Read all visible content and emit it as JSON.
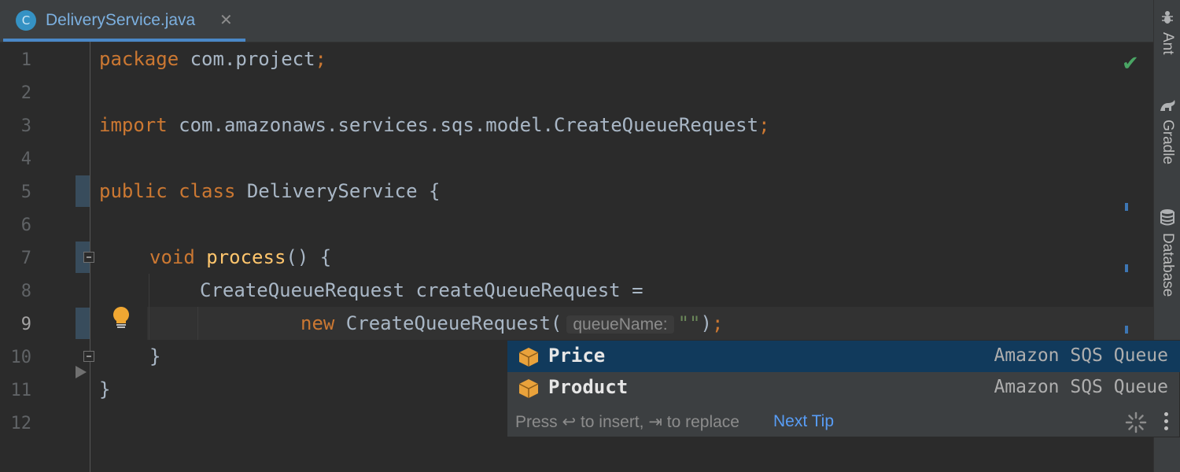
{
  "tab": {
    "title": "DeliveryService.java",
    "icon": "C",
    "close": "✕"
  },
  "toolwindows": [
    {
      "label": "Ant",
      "icon": "ant-icon"
    },
    {
      "label": "Gradle",
      "icon": "gradle-icon"
    },
    {
      "label": "Database",
      "icon": "database-icon"
    }
  ],
  "editor": {
    "line_numbers": [
      "1",
      "2",
      "3",
      "4",
      "5",
      "6",
      "7",
      "8",
      "9",
      "10",
      "11",
      "12"
    ],
    "current_line": "9",
    "code": {
      "l1_kw": "package",
      "l1_rest": " com.project",
      "l1_semi": ";",
      "l3_kw": "import",
      "l3_rest": " com.amazonaws.services.sqs.model.CreateQueueRequest",
      "l3_semi": ";",
      "l5_kw": "public class",
      "l5_rest": " DeliveryService {",
      "l7_kw": "void",
      "l7_fn": "process",
      "l7_rest": "() {",
      "l8_text": "CreateQueueRequest createQueueRequest =",
      "l9_kw": "new",
      "l9_class": " CreateQueueRequest(",
      "l9_hint": "queueName:",
      "l9_str": "\"\"",
      "l9_close": ")",
      "l9_semi": ";",
      "l10_text": "}",
      "l11_text": "}"
    },
    "inspection_status": "ok"
  },
  "completion": {
    "items": [
      {
        "label": "Price",
        "type": "Amazon SQS Queue",
        "selected": true
      },
      {
        "label": "Product",
        "type": "Amazon SQS Queue",
        "selected": false
      }
    ],
    "footer_text": "Press ↩ to insert, ⇥ to replace",
    "next_tip": "Next Tip"
  },
  "colors": {
    "background": "#2b2b2b",
    "keyword": "#cc7832",
    "function": "#ffc66d",
    "string": "#6a8759",
    "selection": "#113a5c",
    "link": "#589df6"
  }
}
